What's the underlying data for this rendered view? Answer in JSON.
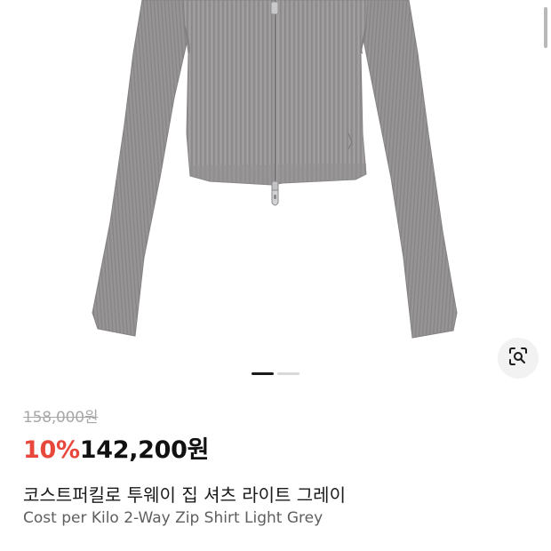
{
  "product": {
    "image_alt": "product-photo",
    "pager": {
      "count": 2,
      "active_index": 0
    },
    "lens_icon": "image-search-icon",
    "original_price": "158,000원",
    "discount": "10%",
    "sale_price": "142,200원",
    "title_ko": "코스트퍼킬로 투웨이 집 셔츠 라이트 그레이",
    "title_en": "Cost per Kilo 2-Way Zip Shirt Light Grey"
  },
  "colors": {
    "discount": "#e8483c",
    "garment": "#9a9799"
  }
}
